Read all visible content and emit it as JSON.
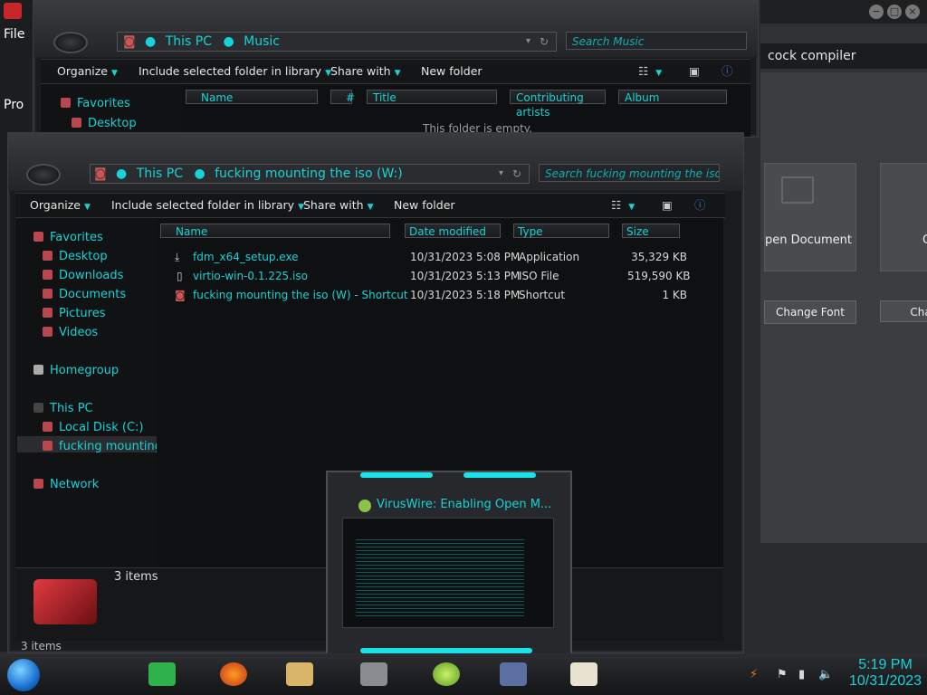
{
  "background_app": {
    "title": "cock compiler",
    "tiles": [
      {
        "label": "pen Document"
      },
      {
        "label": "C"
      }
    ],
    "buttons": [
      {
        "label": "Change Font"
      },
      {
        "label": "Cha"
      }
    ]
  },
  "left_strip": {
    "menu_file": "File",
    "menu_pro": "Pro"
  },
  "music_window": {
    "breadcrumb": {
      "root": "This PC",
      "folder": "Music"
    },
    "search_placeholder": "Search Music",
    "toolbar": {
      "organize": "Organize",
      "include": "Include selected folder in library",
      "share": "Share with",
      "new_folder": "New folder"
    },
    "nav": [
      {
        "label": "Favorites"
      },
      {
        "label": "Desktop"
      }
    ],
    "columns": [
      {
        "label": "Name"
      },
      {
        "label": "#"
      },
      {
        "label": "Title"
      },
      {
        "label": "Contributing artists"
      },
      {
        "label": "Album"
      }
    ],
    "empty_text": "This folder is empty."
  },
  "iso_window": {
    "breadcrumb": {
      "root": "This PC",
      "folder": "fucking mounting the iso (W:)"
    },
    "search_placeholder": "Search fucking mounting the iso (...",
    "toolbar": {
      "organize": "Organize",
      "include": "Include selected folder in library",
      "share": "Share with",
      "new_folder": "New folder"
    },
    "nav": {
      "favorites": "Favorites",
      "desktop": "Desktop",
      "downloads": "Downloads",
      "documents": "Documents",
      "pictures": "Pictures",
      "videos": "Videos",
      "homegroup": "Homegroup",
      "this_pc": "This PC",
      "local_disk": "Local Disk (C:)",
      "iso_drive": "fucking mounting t",
      "network": "Network"
    },
    "columns": {
      "name": "Name",
      "date": "Date modified",
      "type": "Type",
      "size": "Size"
    },
    "files": [
      {
        "name": "fdm_x64_setup.exe",
        "date": "10/31/2023 5:08 PM",
        "type": "Application",
        "size": "35,329 KB"
      },
      {
        "name": "virtio-win-0.1.225.iso",
        "date": "10/31/2023 5:13 PM",
        "type": "ISO File",
        "size": "519,590 KB"
      },
      {
        "name": "fucking mounting the iso (W) - Shortcut",
        "date": "10/31/2023 5:18 PM",
        "type": "Shortcut",
        "size": "1 KB"
      }
    ],
    "details_count": "3 items",
    "status_text": "3 items"
  },
  "popup": {
    "title": "VirusWire: Enabling Open M..."
  },
  "tray": {
    "time": "5:19 PM",
    "date": "10/31/2023"
  },
  "colors": {
    "accent": "#16d3d8",
    "frame": "#2b2c2f",
    "content": "#111213"
  }
}
